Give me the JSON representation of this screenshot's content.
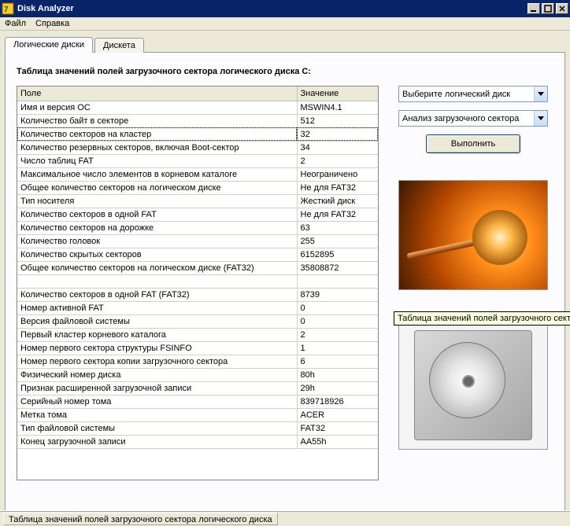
{
  "window": {
    "title": "Disk Analyzer"
  },
  "menu": {
    "file": "Файл",
    "help": "Справка"
  },
  "tabs": {
    "logical": "Логические диски",
    "floppy": "Дискета"
  },
  "panel": {
    "heading": "Таблица значений полей загрузочного сектора логического диска C:"
  },
  "table": {
    "col_field": "Поле",
    "col_value": "Значение",
    "rows": [
      {
        "field": "Имя и версия ОС",
        "value": "MSWIN4.1"
      },
      {
        "field": "Количество байт в секторе",
        "value": "512"
      },
      {
        "field": "Количество секторов на кластер",
        "value": "32",
        "selected": true
      },
      {
        "field": "Количество резервных секторов, включая Boot-сектор",
        "value": "34"
      },
      {
        "field": "Число таблиц FAT",
        "value": "2"
      },
      {
        "field": "Максимальное число элементов в корневом каталоге",
        "value": "Неограничено"
      },
      {
        "field": "Общее количество секторов на логическом диске",
        "value": "Не для FAT32"
      },
      {
        "field": "Тип носителя",
        "value": "Жесткий диск"
      },
      {
        "field": "Количество секторов в одной FAT",
        "value": "Не для FAT32"
      },
      {
        "field": "Количество секторов на дорожке",
        "value": "63"
      },
      {
        "field": "Количество головок",
        "value": "255"
      },
      {
        "field": "Количество скрытых секторов",
        "value": "6152895"
      },
      {
        "field": "Общее количество секторов на логическом диске (FAT32)",
        "value": "35808872"
      },
      {
        "field": "",
        "value": ""
      },
      {
        "field": "Количество секторов в одной FAT (FAT32)",
        "value": "8739"
      },
      {
        "field": "Номер активной FAT",
        "value": "0"
      },
      {
        "field": "Версия файловой системы",
        "value": "0"
      },
      {
        "field": "Первый кластер корневого каталога",
        "value": "2"
      },
      {
        "field": "Номер первого сектора структуры FSINFO",
        "value": "1"
      },
      {
        "field": "Номер первого сектора копии загрузочного сектора",
        "value": "6"
      },
      {
        "field": "Физический номер диска",
        "value": "80h"
      },
      {
        "field": "Признак расширенной загрузочной записи",
        "value": "29h"
      },
      {
        "field": "Серийный номер тома",
        "value": "839718926"
      },
      {
        "field": "Метка тома",
        "value": "ACER"
      },
      {
        "field": "Тип файловой системы",
        "value": "FAT32"
      },
      {
        "field": "Конец загрузочной записи",
        "value": "AA55h"
      }
    ]
  },
  "side": {
    "select_disk": "Выберите логический диск",
    "analysis": "Анализ загрузочного сектора",
    "execute": "Выполнить"
  },
  "tooltip": {
    "text": "Таблица значений  полей загрузочного сектора логичес"
  },
  "status": {
    "text": "Таблица значений  полей загрузочного сектора логического диска"
  }
}
